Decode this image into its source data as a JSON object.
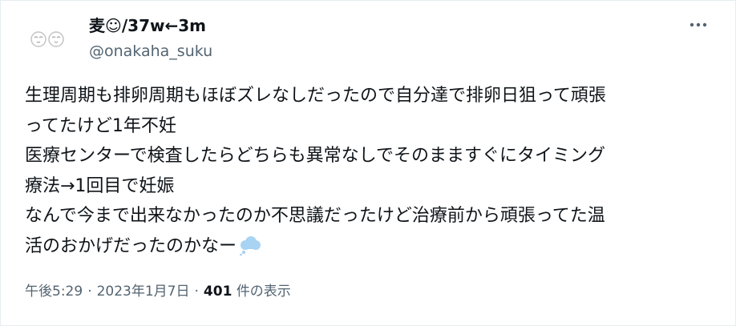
{
  "tweet": {
    "author": {
      "display_name": "麦☺/37w←3m",
      "handle": "@onakaha_suku",
      "avatar_icon": "sleepy-face-avatar-icon"
    },
    "more_icon": "more-horizontal-icon",
    "text_lines": [
      "生理周期も排卵周期もほぼズレなしだったので自分達で排卵日狙って頑張",
      "ってたけど1年不妊",
      "医療センターで検査したらどちらも異常なしでそのまますぐにタイミング",
      "療法→1回目で妊娠",
      "なんで今まで出来なかったのか不思議だったけど治療前から頑張ってた温",
      "活のおかげだったのかなー"
    ],
    "trailing_emoji": "thought-balloon-icon",
    "meta": {
      "time": "午後5:29",
      "separator": "·",
      "date": "2023年1月7日",
      "views_count": "401",
      "views_label": "件の表示"
    }
  },
  "colors": {
    "text_primary": "#0f1419",
    "text_secondary": "#536471",
    "border": "#e6ecf0",
    "emoji_cloud": "#a9d3f2"
  }
}
